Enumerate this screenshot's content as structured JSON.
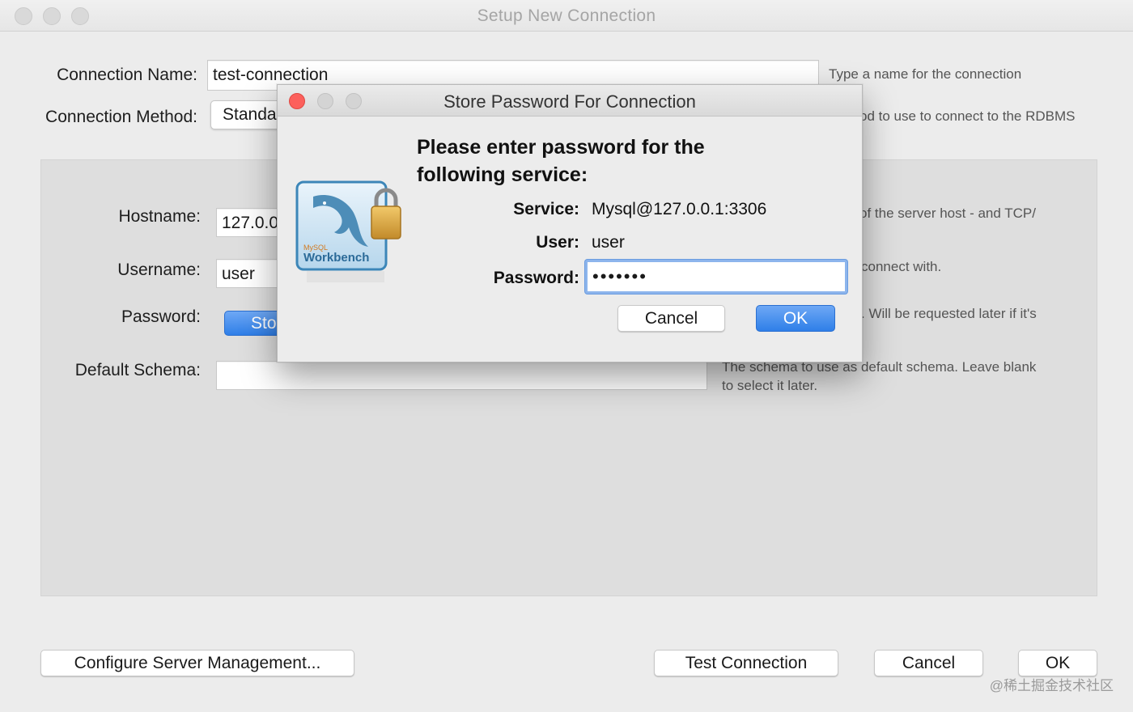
{
  "window": {
    "title": "Setup New Connection"
  },
  "form": {
    "connection_name_label": "Connection Name:",
    "connection_name_value": "test-connection",
    "connection_name_hint": "Type a name for the connection",
    "connection_method_label": "Connection Method:",
    "connection_method_value": "Standa",
    "connection_method_hint": "od to use to connect to the RDBMS",
    "hostname_label": "Hostname:",
    "hostname_value": "127.0.0.",
    "hostname_hint": "of the server host - and TCP/",
    "username_label": "Username:",
    "username_value": "user",
    "username_hint": "connect with.",
    "password_label": "Password:",
    "password_button_label": "Sto",
    "password_hint": ". Will be requested later if it's",
    "default_schema_label": "Default Schema:",
    "default_schema_value": "",
    "default_schema_hint_line1": "The schema to use as default schema. Leave blank",
    "default_schema_hint_line2": "to select it later."
  },
  "footer": {
    "configure_label": "Configure Server Management...",
    "test_label": "Test Connection",
    "cancel_label": "Cancel",
    "ok_label": "OK"
  },
  "dialog": {
    "title": "Store Password For Connection",
    "prompt_line1": "Please enter password for the",
    "prompt_line2": "following service:",
    "service_label": "Service:",
    "service_value": "Mysql@127.0.0.1:3306",
    "user_label": "User:",
    "user_value": "user",
    "password_label": "Password:",
    "password_value": "•••••••",
    "cancel_label": "Cancel",
    "ok_label": "OK",
    "logo_text_small": "MySQL",
    "logo_text": "Workbench"
  },
  "watermark": "@稀土掘金技术社区",
  "colors": {
    "accent": "#2f7fe8",
    "focus_ring": "#8db5ec",
    "close": "#fc605c"
  }
}
